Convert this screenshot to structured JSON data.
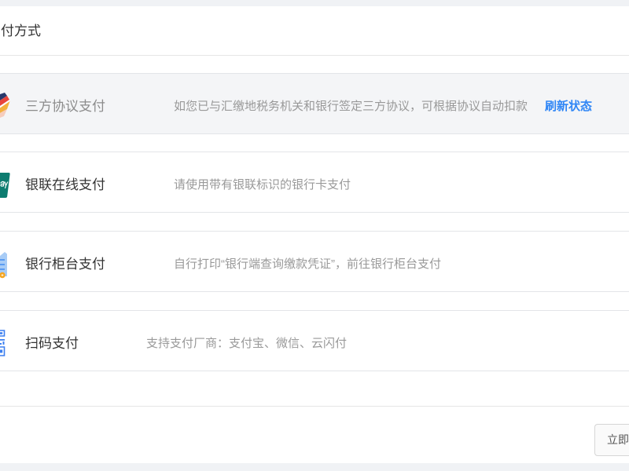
{
  "page": {
    "title": "付方式"
  },
  "colors": {
    "page_bg": "#f0f2f5",
    "card_bg": "#ffffff",
    "accent": "#2f86f6",
    "text_primary": "#333333",
    "text_secondary": "#999999",
    "text_disabled": "#8c8c8c",
    "border": "#e3e5e8",
    "divider": "#e6e6e6",
    "disabled_row_bg": "#f4f5f7",
    "button_bg": "#fafafa",
    "button_border": "#d6d6d6"
  },
  "payment_methods": [
    {
      "icon": "agreement-card-icon",
      "label": "三方协议支付",
      "description": "如您已与汇缴地税务机关和银行签定三方协议，可根据协议自动扣款",
      "action_label": "刷新状态"
    },
    {
      "icon": "unionpay-icon",
      "label": "银联在线支付",
      "description": "请使用带有银联标识的银行卡支付"
    },
    {
      "icon": "bank-counter-icon",
      "label": "银行柜台支付",
      "description": "自行打印“银行端查询缴款凭证”，前往银行柜台支付"
    },
    {
      "icon": "qr-code-icon",
      "label": "扫码支付",
      "description": "支持支付厂商：支付宝、微信、云闪付"
    }
  ],
  "footer": {
    "submit_label": "立即"
  }
}
